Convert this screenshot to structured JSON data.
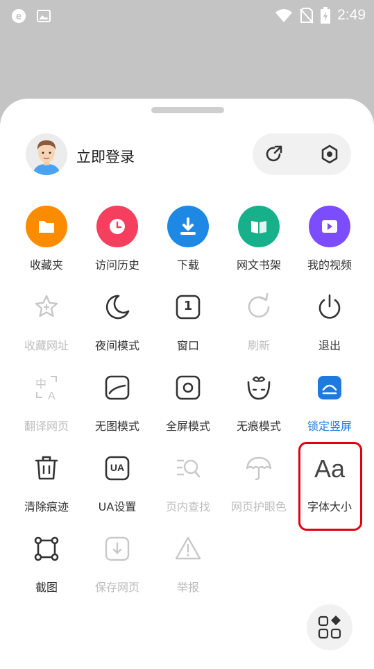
{
  "status_bar": {
    "time": "2:49",
    "left_icons": [
      "browser-e-icon",
      "image-icon"
    ],
    "right_icons": [
      "wifi-icon",
      "no-sim-icon",
      "battery-charging-icon"
    ]
  },
  "header": {
    "login_label": "立即登录",
    "actions": [
      "share-refresh-icon",
      "settings-hex-icon"
    ]
  },
  "grid": {
    "row1": [
      {
        "label": "收藏夹",
        "icon": "folder-icon",
        "color": "#fb8c00"
      },
      {
        "label": "访问历史",
        "icon": "clock-icon",
        "color": "#f43f5e"
      },
      {
        "label": "下载",
        "icon": "download-icon",
        "color": "#1e88e5"
      },
      {
        "label": "网文书架",
        "icon": "book-icon",
        "color": "#16b08a"
      },
      {
        "label": "我的视频",
        "icon": "video-icon",
        "color": "#7c4dff"
      }
    ],
    "row2": [
      {
        "label": "收藏网址",
        "icon": "star-plus-icon",
        "disabled": true
      },
      {
        "label": "夜间模式",
        "icon": "moon-icon"
      },
      {
        "label": "窗口",
        "icon": "window-count-icon",
        "count": "1"
      },
      {
        "label": "刷新",
        "icon": "refresh-icon",
        "disabled": true
      },
      {
        "label": "退出",
        "icon": "power-icon"
      }
    ],
    "row3": [
      {
        "label": "翻译网页",
        "icon": "translate-icon",
        "disabled": true
      },
      {
        "label": "无图模式",
        "icon": "no-image-icon"
      },
      {
        "label": "全屏模式",
        "icon": "fullscreen-icon"
      },
      {
        "label": "无痕模式",
        "icon": "incognito-icon"
      },
      {
        "label": "锁定竖屏",
        "icon": "lock-portrait-icon",
        "active": true
      }
    ],
    "row4": [
      {
        "label": "清除痕迹",
        "icon": "trash-icon"
      },
      {
        "label": "UA设置",
        "icon": "ua-icon",
        "badge": "UA"
      },
      {
        "label": "页内查找",
        "icon": "find-in-page-icon",
        "disabled": true
      },
      {
        "label": "网页护眼色",
        "icon": "umbrella-icon",
        "disabled": true
      },
      {
        "label": "字体大小",
        "icon": "font-size-icon",
        "glyph": "Aa"
      }
    ],
    "row5": [
      {
        "label": "截图",
        "icon": "crop-icon"
      },
      {
        "label": "保存网页",
        "icon": "save-page-icon",
        "disabled": true
      },
      {
        "label": "举报",
        "icon": "warning-icon",
        "disabled": true
      }
    ]
  },
  "fab": {
    "icon": "apps-grid-icon"
  },
  "colors": {
    "active_blue": "#1f7ae0",
    "highlight_red": "#e00012",
    "disabled_gray": "#bdbdbd"
  }
}
